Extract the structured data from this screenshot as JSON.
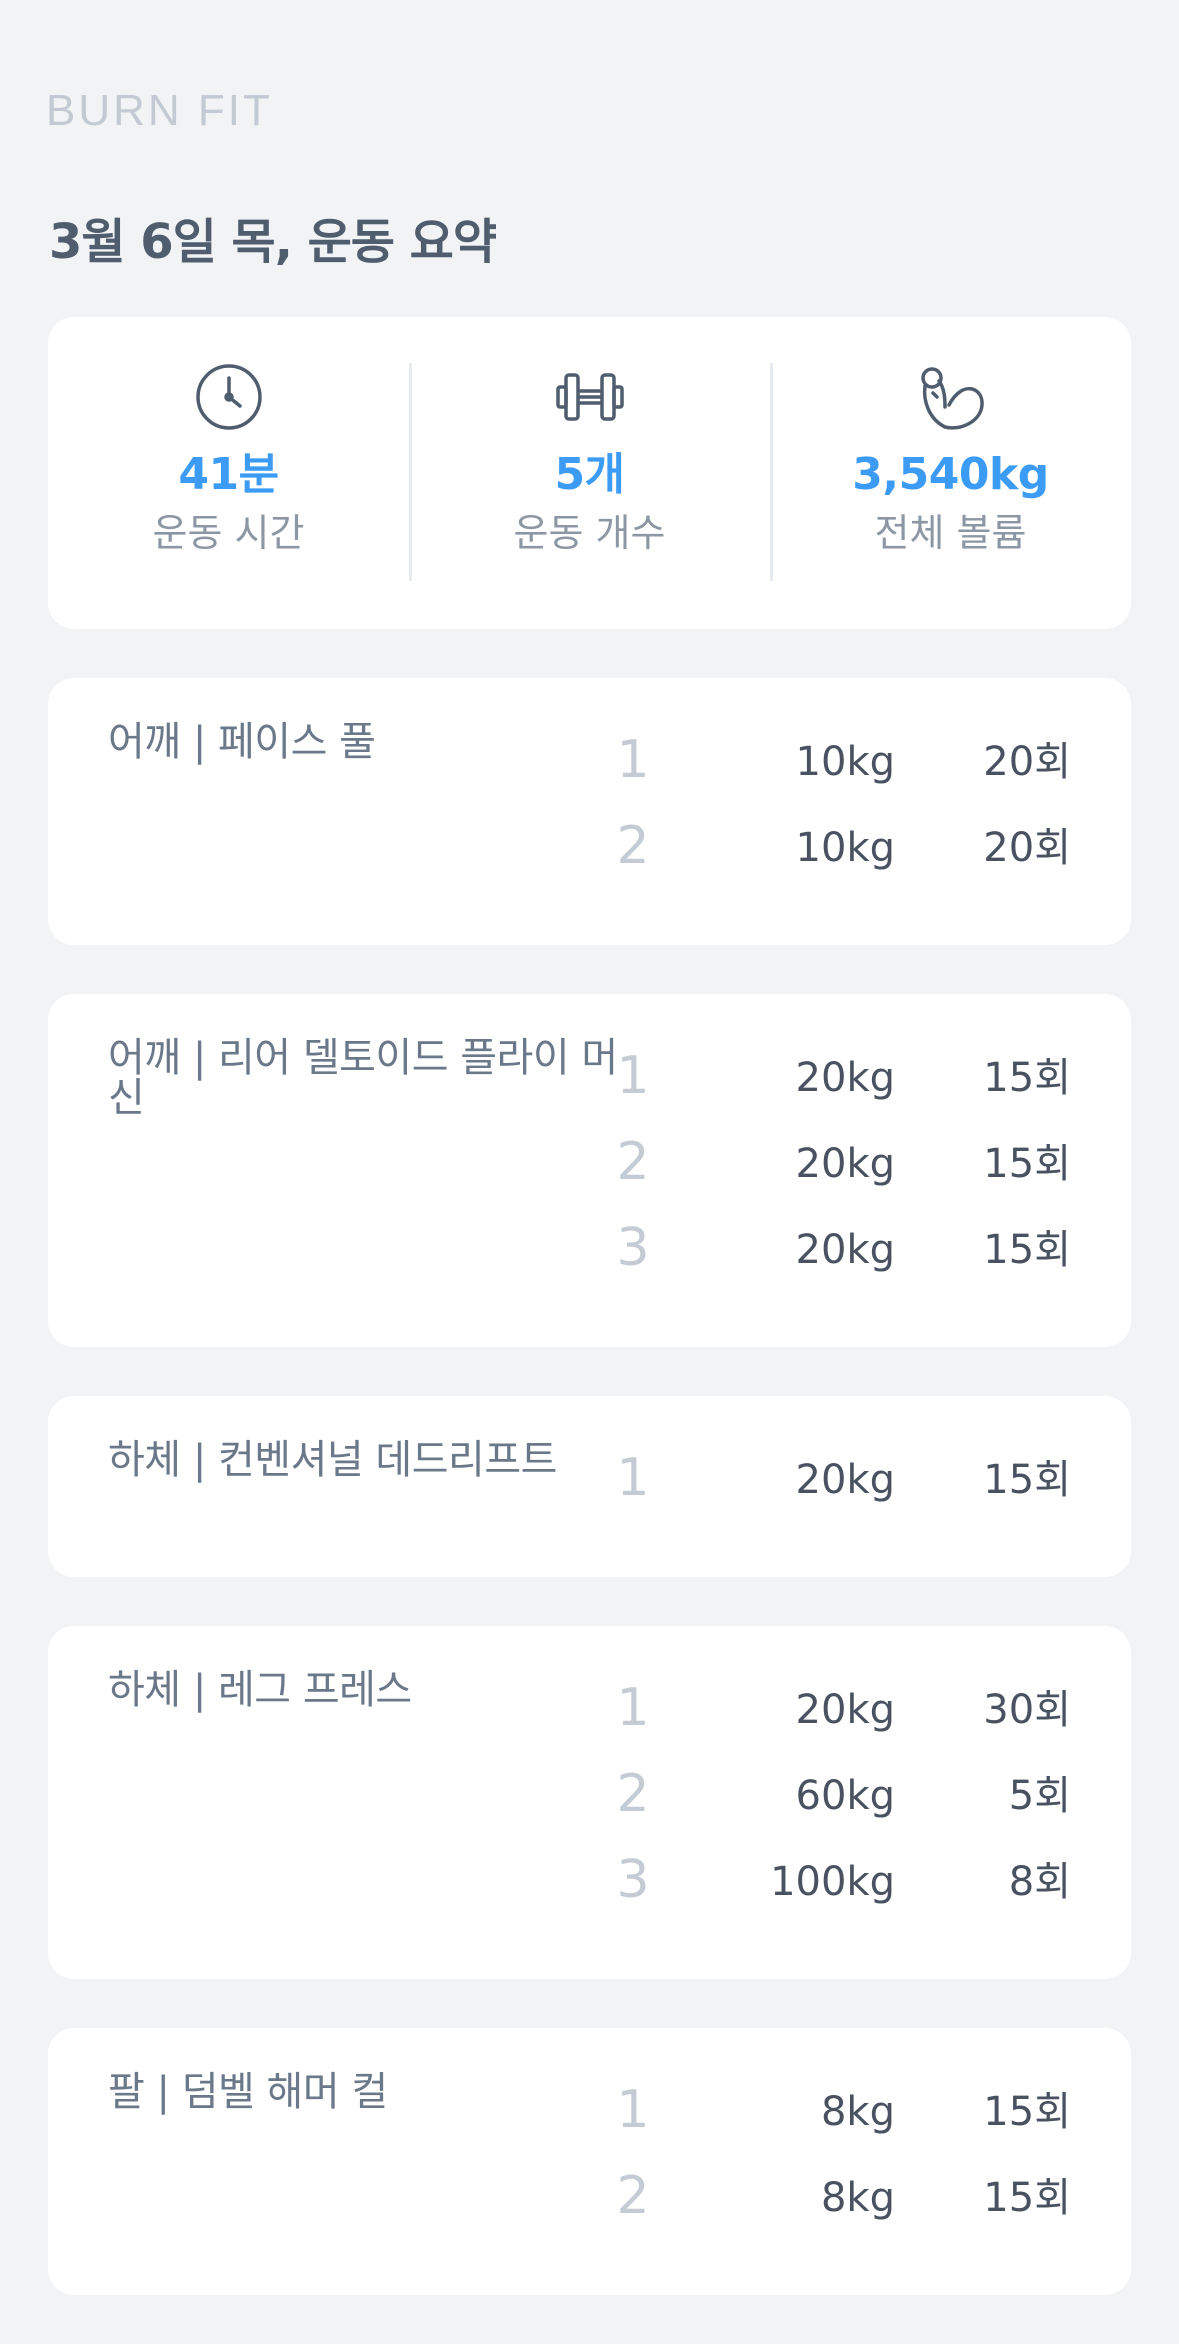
{
  "app": {
    "logo_text": "BURN FIT"
  },
  "header": {
    "title": "3월 6일 목, 운동 요약"
  },
  "summary": {
    "stats": [
      {
        "icon": "clock-icon",
        "value": "41분",
        "label": "운동 시간"
      },
      {
        "icon": "dumbbell-icon",
        "value": "5개",
        "label": "운동 개수"
      },
      {
        "icon": "flexed-arm-icon",
        "value": "3,540kg",
        "label": "전체 볼륨"
      }
    ],
    "accent_color": "#3b9bf5"
  },
  "exercises": [
    {
      "name": "어깨 | 페이스 풀",
      "sets": [
        {
          "no": "1",
          "weight": "10kg",
          "reps": "20회"
        },
        {
          "no": "2",
          "weight": "10kg",
          "reps": "20회"
        }
      ]
    },
    {
      "name": "어깨 | 리어 델토이드 플라이 머신",
      "sets": [
        {
          "no": "1",
          "weight": "20kg",
          "reps": "15회"
        },
        {
          "no": "2",
          "weight": "20kg",
          "reps": "15회"
        },
        {
          "no": "3",
          "weight": "20kg",
          "reps": "15회"
        }
      ]
    },
    {
      "name": "하체 | 컨벤셔널 데드리프트",
      "sets": [
        {
          "no": "1",
          "weight": "20kg",
          "reps": "15회"
        }
      ]
    },
    {
      "name": "하체 | 레그 프레스",
      "sets": [
        {
          "no": "1",
          "weight": "20kg",
          "reps": "30회"
        },
        {
          "no": "2",
          "weight": "60kg",
          "reps": "5회"
        },
        {
          "no": "3",
          "weight": "100kg",
          "reps": "8회"
        }
      ]
    },
    {
      "name": "팔 | 덤벨 해머 컬",
      "sets": [
        {
          "no": "1",
          "weight": "8kg",
          "reps": "15회"
        },
        {
          "no": "2",
          "weight": "8kg",
          "reps": "15회"
        }
      ]
    }
  ]
}
